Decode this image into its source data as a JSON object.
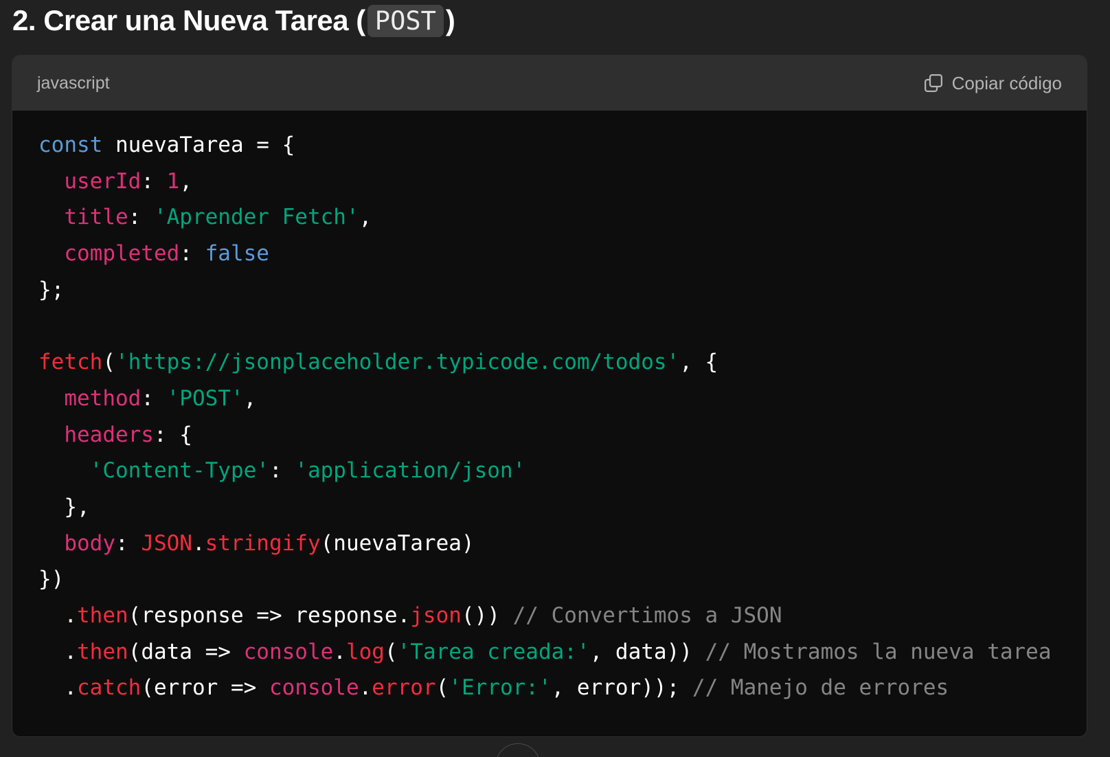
{
  "heading": {
    "prefix": "2. Crear una Nueva Tarea (",
    "code": "POST",
    "suffix": ")"
  },
  "code_block": {
    "language": "javascript",
    "copy_label": "Copiar código",
    "copy_icon": "copy-icon",
    "lines": [
      [
        {
          "t": "kw",
          "v": "const"
        },
        {
          "t": "plain",
          "v": " nuevaTarea = {"
        }
      ],
      [
        {
          "t": "plain",
          "v": "  "
        },
        {
          "t": "prop",
          "v": "userId"
        },
        {
          "t": "plain",
          "v": ": "
        },
        {
          "t": "num",
          "v": "1"
        },
        {
          "t": "plain",
          "v": ","
        }
      ],
      [
        {
          "t": "plain",
          "v": "  "
        },
        {
          "t": "prop",
          "v": "title"
        },
        {
          "t": "plain",
          "v": ": "
        },
        {
          "t": "str",
          "v": "'Aprender Fetch'"
        },
        {
          "t": "plain",
          "v": ","
        }
      ],
      [
        {
          "t": "plain",
          "v": "  "
        },
        {
          "t": "prop",
          "v": "completed"
        },
        {
          "t": "plain",
          "v": ": "
        },
        {
          "t": "kw",
          "v": "false"
        }
      ],
      [
        {
          "t": "plain",
          "v": "};"
        }
      ],
      [],
      [
        {
          "t": "fn",
          "v": "fetch"
        },
        {
          "t": "plain",
          "v": "("
        },
        {
          "t": "str",
          "v": "'https://jsonplaceholder.typicode.com/todos'"
        },
        {
          "t": "plain",
          "v": ", {"
        }
      ],
      [
        {
          "t": "plain",
          "v": "  "
        },
        {
          "t": "prop",
          "v": "method"
        },
        {
          "t": "plain",
          "v": ": "
        },
        {
          "t": "str",
          "v": "'POST'"
        },
        {
          "t": "plain",
          "v": ","
        }
      ],
      [
        {
          "t": "plain",
          "v": "  "
        },
        {
          "t": "prop",
          "v": "headers"
        },
        {
          "t": "plain",
          "v": ": {"
        }
      ],
      [
        {
          "t": "plain",
          "v": "    "
        },
        {
          "t": "str",
          "v": "'Content-Type'"
        },
        {
          "t": "plain",
          "v": ": "
        },
        {
          "t": "str",
          "v": "'application/json'"
        }
      ],
      [
        {
          "t": "plain",
          "v": "  },"
        }
      ],
      [
        {
          "t": "plain",
          "v": "  "
        },
        {
          "t": "prop",
          "v": "body"
        },
        {
          "t": "plain",
          "v": ": "
        },
        {
          "t": "fn",
          "v": "JSON"
        },
        {
          "t": "plain",
          "v": "."
        },
        {
          "t": "fn",
          "v": "stringify"
        },
        {
          "t": "plain",
          "v": "(nuevaTarea)"
        }
      ],
      [
        {
          "t": "plain",
          "v": "})"
        }
      ],
      [
        {
          "t": "plain",
          "v": "  ."
        },
        {
          "t": "fn",
          "v": "then"
        },
        {
          "t": "plain",
          "v": "(response => response."
        },
        {
          "t": "fn",
          "v": "json"
        },
        {
          "t": "plain",
          "v": "()) "
        },
        {
          "t": "com",
          "v": "// Convertimos a JSON"
        }
      ],
      [
        {
          "t": "plain",
          "v": "  ."
        },
        {
          "t": "fn",
          "v": "then"
        },
        {
          "t": "plain",
          "v": "(data => "
        },
        {
          "t": "prop",
          "v": "console"
        },
        {
          "t": "plain",
          "v": "."
        },
        {
          "t": "fn",
          "v": "log"
        },
        {
          "t": "plain",
          "v": "("
        },
        {
          "t": "str",
          "v": "'Tarea creada:'"
        },
        {
          "t": "plain",
          "v": ", data)) "
        },
        {
          "t": "com",
          "v": "// Mostramos la nueva tarea"
        }
      ],
      [
        {
          "t": "plain",
          "v": "  ."
        },
        {
          "t": "fn",
          "v": "catch"
        },
        {
          "t": "plain",
          "v": "(error => "
        },
        {
          "t": "prop",
          "v": "console"
        },
        {
          "t": "plain",
          "v": "."
        },
        {
          "t": "fn",
          "v": "error"
        },
        {
          "t": "plain",
          "v": "("
        },
        {
          "t": "str",
          "v": "'Error:'"
        },
        {
          "t": "plain",
          "v": ", error)); "
        },
        {
          "t": "com",
          "v": "// Manejo de errores"
        }
      ]
    ]
  },
  "colors": {
    "page_background": "#212121",
    "code_background": "#0d0d0d",
    "header_background": "#2f2f2f",
    "keyword": "#5b9bd9",
    "property": "#df3079",
    "string": "#00a67d",
    "function": "#f22c3d",
    "comment": "#858585"
  },
  "scroll_button_icon": "scroll-down-icon"
}
